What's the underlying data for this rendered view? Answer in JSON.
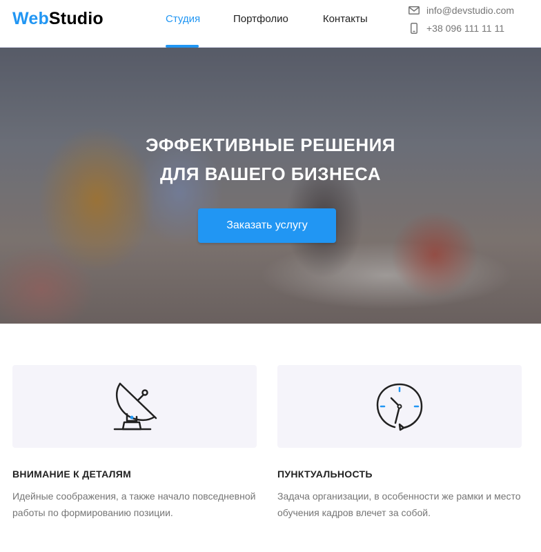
{
  "header": {
    "logo_part1": "Web",
    "logo_part2": "Studio",
    "nav": [
      {
        "label": "Студия",
        "active": true
      },
      {
        "label": "Портфолио",
        "active": false
      },
      {
        "label": "Контакты",
        "active": false
      }
    ],
    "email": "info@devstudio.com",
    "phone": "+38 096 111 11 11",
    "email_icon": "mail-icon",
    "phone_icon": "phone-icon"
  },
  "hero": {
    "title_line1": "ЭФФЕКТИВНЫЕ РЕШЕНИЯ",
    "title_line2": "ДЛЯ ВАШЕГО БИЗНЕСА",
    "button_label": "Заказать услугу"
  },
  "features": [
    {
      "icon": "satellite-dish-icon",
      "title": "ВНИМАНИЕ К ДЕТАЛЯМ",
      "text": "Идейные соображения, а также начало повседневной работы по формированию позиции."
    },
    {
      "icon": "clock-icon",
      "title": "ПУНКТУАЛЬНОСТЬ",
      "text": "Задача организации, в особенности же рамки и место обучения кадров влечет за собой."
    }
  ],
  "colors": {
    "accent": "#2196f3",
    "text": "#212121",
    "muted": "#757575",
    "feature_bg": "#f5f4fa"
  }
}
